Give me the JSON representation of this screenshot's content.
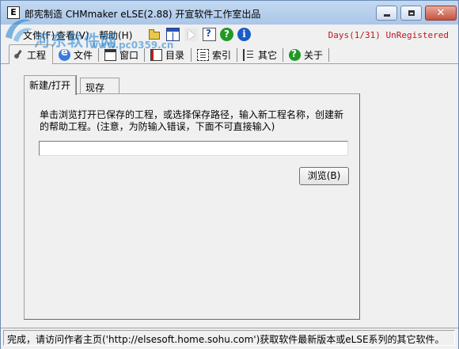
{
  "window": {
    "icon_letter": "E",
    "title": "郎宪制造 CHMmaker eLSE(2.88) 开宣软件工作室出品",
    "buttons": {
      "minimize": "minimize-icon",
      "maximize": "maximize-icon",
      "close": "close-icon"
    }
  },
  "menu": {
    "file": "文件(F)",
    "view": "查看(V)",
    "help": "帮助(H)",
    "toolbar_icons": [
      "open-folder-icon",
      "window-layout-icon",
      "play-icon",
      "help-document-icon",
      "help-question-icon",
      "info-icon"
    ],
    "registration": "Days(1/31) UnRegistered"
  },
  "tabs": [
    {
      "label": "工程",
      "icon": "project-icon",
      "active": true
    },
    {
      "label": "文件",
      "icon": "ie-icon"
    },
    {
      "label": "窗口",
      "icon": "window-icon"
    },
    {
      "label": "目录",
      "icon": "book-icon"
    },
    {
      "label": "索引",
      "icon": "index-icon"
    },
    {
      "label": "其它",
      "icon": "list-icon"
    },
    {
      "label": "关于",
      "icon": "about-icon"
    }
  ],
  "project_page": {
    "subtabs": [
      "新建/打开",
      "现存"
    ],
    "instruction": "单击浏览打开已保存的工程，或选择保存路径，输入新工程名称，创建新的帮助工程。(注意，为防输入错误，下面不可直接输入)",
    "path_value": "",
    "browse_label": "浏览(B)"
  },
  "status": {
    "text": "完成，请访问作者主页('http://elsesoft.home.sohu.com')获取软件最新版本或eLSE系列的其它软件。"
  },
  "watermark": {
    "text": "河东软件网",
    "url": "www.pc0359.cn"
  },
  "colors": {
    "registration_text": "#c0161b",
    "watermark": "#1a7fd0",
    "titlebar": "#c4d9f1",
    "close_button": "#c7513f"
  }
}
